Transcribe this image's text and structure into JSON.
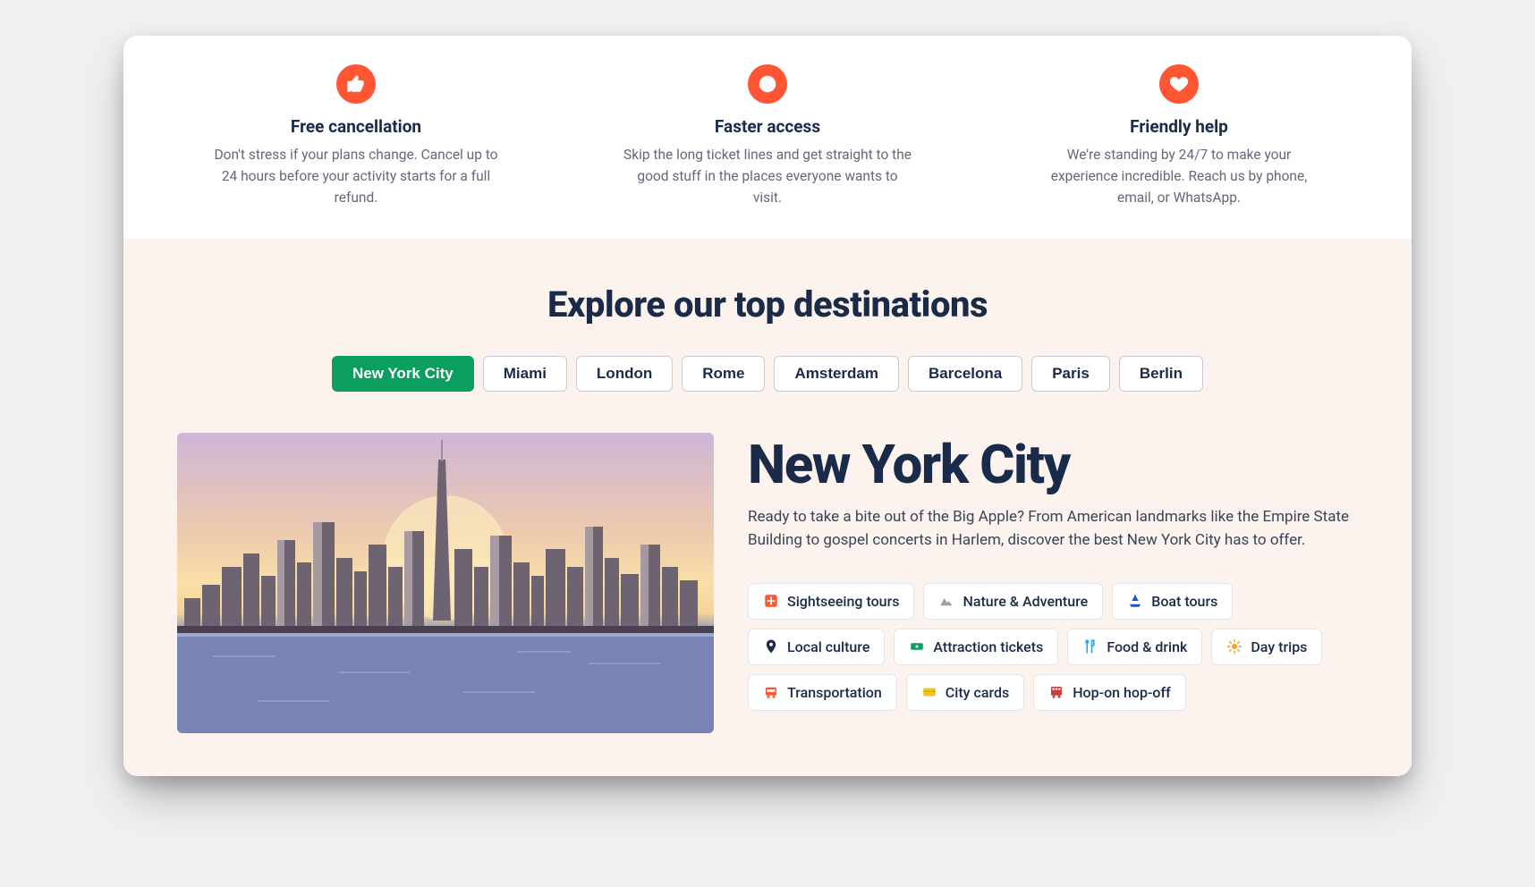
{
  "features": [
    {
      "title": "Free cancellation",
      "desc": "Don't stress if your plans change. Cancel up to 24 hours before your activity starts for a full refund."
    },
    {
      "title": "Faster access",
      "desc": "Skip the long ticket lines and get straight to the good stuff in the places everyone wants to visit."
    },
    {
      "title": "Friendly help",
      "desc": "We're standing by 24/7 to make your experience incredible. Reach us by phone, email, or WhatsApp."
    }
  ],
  "explore": {
    "heading": "Explore our top destinations",
    "tabs": [
      "New York City",
      "Miami",
      "London",
      "Rome",
      "Amsterdam",
      "Barcelona",
      "Paris",
      "Berlin"
    ],
    "active_tab": "New York City",
    "destination": {
      "title": "New York City",
      "desc": "Ready to take a bite out of the Big Apple? From American landmarks like the Empire State Building to gospel concerts in Harlem, discover the best New York City has to offer.",
      "categories": [
        "Sightseeing tours",
        "Nature & Adventure",
        "Boat tours",
        "Local culture",
        "Attraction tickets",
        "Food & drink",
        "Day trips",
        "Transportation",
        "City cards",
        "Hop-on hop-off"
      ]
    }
  },
  "colors": {
    "accent_orange": "#ff5533",
    "tab_active": "#0a9e5f",
    "heading": "#1a2b49",
    "body": "#63687a",
    "section_bg": "#fcf3ee"
  }
}
